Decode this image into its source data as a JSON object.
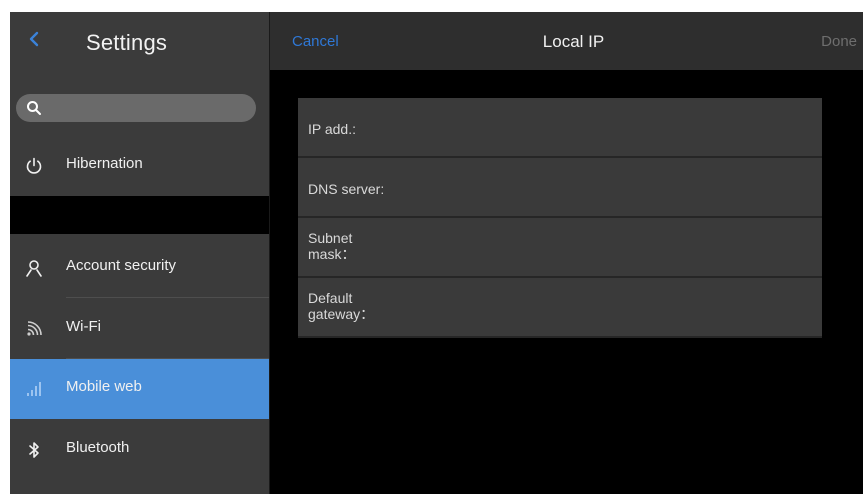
{
  "sidebar": {
    "title": "Settings",
    "search": {
      "placeholder": "",
      "value": ""
    },
    "items": [
      {
        "label": "Hibernation",
        "icon": "power-icon",
        "active": false
      },
      {
        "label": "Account security",
        "icon": "user-icon",
        "active": false
      },
      {
        "label": "Wi-Fi",
        "icon": "wifi-icon",
        "active": false
      },
      {
        "label": "Mobile web",
        "icon": "signal-icon",
        "active": true
      },
      {
        "label": "Bluetooth",
        "icon": "bluetooth-icon",
        "active": false
      }
    ]
  },
  "header": {
    "cancel_label": "Cancel",
    "title": "Local IP",
    "done_label": "Done"
  },
  "form": {
    "fields": [
      {
        "label": "IP add.:",
        "value": ""
      },
      {
        "label": "DNS server:",
        "value": ""
      },
      {
        "label": "Subnet\nmask：",
        "value": ""
      },
      {
        "label": "Default\ngateway：",
        "value": ""
      }
    ]
  },
  "colors": {
    "accent": "#4a8fd9",
    "link": "#2f78d6",
    "sidebar_bg": "#3b3b3b",
    "content_bg": "#000000",
    "field_bg": "#3a3a3a"
  }
}
